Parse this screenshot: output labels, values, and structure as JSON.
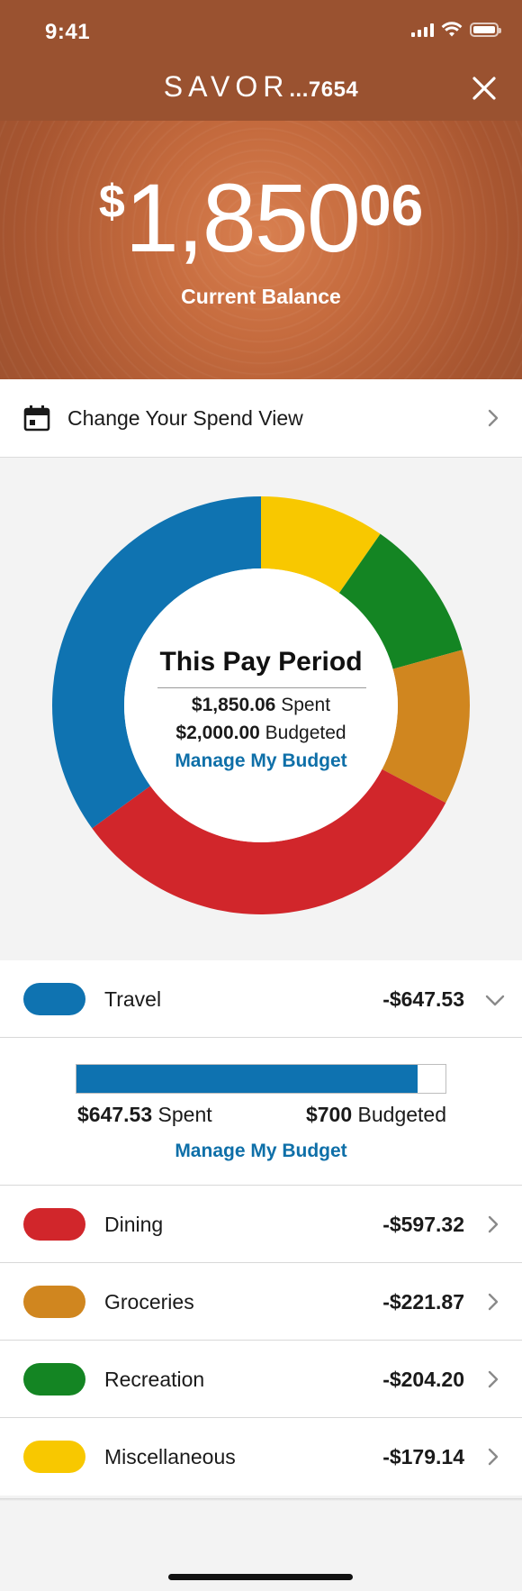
{
  "status_bar": {
    "time": "9:41"
  },
  "header": {
    "brand_name": "SAVOR",
    "account_mask": "...7654",
    "balance_symbol": "$",
    "balance_main": "1,850",
    "balance_cents": "06",
    "balance_label": "Current Balance",
    "colors": {
      "top_bar": "#9a5230",
      "hero": "#c56b3e"
    }
  },
  "spend_view": {
    "label": "Change Your Spend View",
    "icon": "calendar-icon"
  },
  "summary": {
    "title": "This Pay Period",
    "spent_amount": "$1,850.06",
    "spent_word": "Spent",
    "budget_amount": "$2,000.00",
    "budget_word": "Budgeted",
    "manage_link": "Manage My Budget"
  },
  "chart_data": {
    "type": "pie",
    "style": "donut",
    "categories": [
      "Travel",
      "Dining",
      "Groceries",
      "Recreation",
      "Miscellaneous"
    ],
    "values": [
      647.53,
      597.32,
      221.87,
      204.2,
      179.14
    ],
    "colors": [
      "#0f73b1",
      "#d1262b",
      "#d0861f",
      "#148523",
      "#f8c800"
    ],
    "title": "This Pay Period"
  },
  "categories": [
    {
      "name": "Travel",
      "amount": "-$647.53",
      "color": "#0f73b1",
      "expanded": true
    },
    {
      "name": "Dining",
      "amount": "-$597.32",
      "color": "#d1262b",
      "expanded": false
    },
    {
      "name": "Groceries",
      "amount": "-$221.87",
      "color": "#d0861f",
      "expanded": false
    },
    {
      "name": "Recreation",
      "amount": "-$204.20",
      "color": "#148523",
      "expanded": false
    },
    {
      "name": "Miscellaneous",
      "amount": "-$179.14",
      "color": "#f8c800",
      "expanded": false
    }
  ],
  "travel_detail": {
    "spent_amount": "$647.53",
    "spent_word": "Spent",
    "budget_amount": "$700",
    "budget_word": "Budgeted",
    "progress_fraction": 0.925,
    "manage_link": "Manage My Budget"
  }
}
